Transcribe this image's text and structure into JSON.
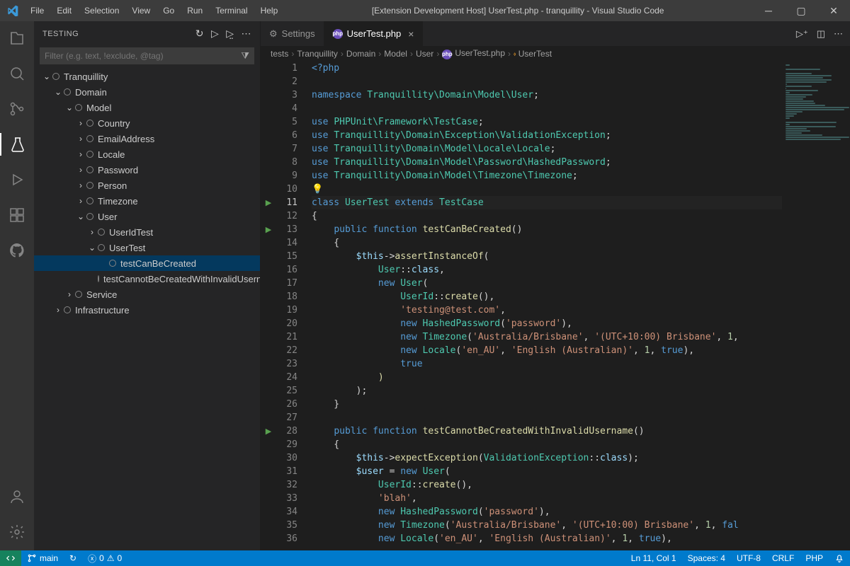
{
  "window": {
    "title": "[Extension Development Host] UserTest.php - tranquillity - Visual Studio Code",
    "menus": [
      "File",
      "Edit",
      "Selection",
      "View",
      "Go",
      "Run",
      "Terminal",
      "Help"
    ]
  },
  "sidebar": {
    "title": "TESTING",
    "filter_placeholder": "Filter (e.g. text, !exclude, @tag)",
    "tree": [
      {
        "indent": 0,
        "expanded": true,
        "label": "Tranquillity"
      },
      {
        "indent": 1,
        "expanded": true,
        "label": "Domain"
      },
      {
        "indent": 2,
        "expanded": true,
        "label": "Model"
      },
      {
        "indent": 3,
        "expanded": false,
        "label": "Country"
      },
      {
        "indent": 3,
        "expanded": false,
        "label": "EmailAddress"
      },
      {
        "indent": 3,
        "expanded": false,
        "label": "Locale"
      },
      {
        "indent": 3,
        "expanded": false,
        "label": "Password"
      },
      {
        "indent": 3,
        "expanded": false,
        "label": "Person"
      },
      {
        "indent": 3,
        "expanded": false,
        "label": "Timezone"
      },
      {
        "indent": 3,
        "expanded": true,
        "label": "User"
      },
      {
        "indent": 4,
        "expanded": false,
        "label": "UserIdTest"
      },
      {
        "indent": 4,
        "expanded": true,
        "label": "UserTest"
      },
      {
        "indent": 5,
        "leaf": true,
        "selected": true,
        "label": "testCanBeCreated"
      },
      {
        "indent": 5,
        "leaf": true,
        "label": "testCannotBeCreatedWithInvalidUsername"
      },
      {
        "indent": 2,
        "expanded": false,
        "label": "Service"
      },
      {
        "indent": 1,
        "expanded": false,
        "label": "Infrastructure"
      }
    ]
  },
  "tabs": [
    {
      "label": "Settings",
      "icon": "gear",
      "active": false,
      "closeable": false
    },
    {
      "label": "UserTest.php",
      "icon": "php",
      "active": true,
      "closeable": true
    }
  ],
  "breadcrumbs": [
    "tests",
    "Tranquillity",
    "Domain",
    "Model",
    "User",
    "UserTest.php",
    "UserTest"
  ],
  "editor": {
    "run_markers": {
      "11": true,
      "13": true,
      "28": true
    },
    "current_line": 11,
    "lines": [
      {
        "n": 1,
        "seg": [
          {
            "c": "kw",
            "t": "<?php"
          }
        ]
      },
      {
        "n": 2,
        "seg": []
      },
      {
        "n": 3,
        "seg": [
          {
            "c": "kw",
            "t": "namespace "
          },
          {
            "c": "ty",
            "t": "Tranquillity\\Domain\\Model\\User"
          },
          {
            "c": "pun",
            "t": ";"
          }
        ]
      },
      {
        "n": 4,
        "seg": []
      },
      {
        "n": 5,
        "seg": [
          {
            "c": "kw",
            "t": "use "
          },
          {
            "c": "ty",
            "t": "PHPUnit\\Framework\\"
          },
          {
            "c": "ty",
            "t": "TestCase"
          },
          {
            "c": "pun",
            "t": ";"
          }
        ]
      },
      {
        "n": 6,
        "seg": [
          {
            "c": "kw",
            "t": "use "
          },
          {
            "c": "ty",
            "t": "Tranquillity\\Domain\\Exception\\"
          },
          {
            "c": "ty",
            "t": "ValidationException"
          },
          {
            "c": "pun",
            "t": ";"
          }
        ]
      },
      {
        "n": 7,
        "seg": [
          {
            "c": "kw",
            "t": "use "
          },
          {
            "c": "ty",
            "t": "Tranquillity\\Domain\\Model\\Locale\\"
          },
          {
            "c": "ty",
            "t": "Locale"
          },
          {
            "c": "pun",
            "t": ";"
          }
        ]
      },
      {
        "n": 8,
        "seg": [
          {
            "c": "kw",
            "t": "use "
          },
          {
            "c": "ty",
            "t": "Tranquillity\\Domain\\Model\\Password\\"
          },
          {
            "c": "ty",
            "t": "HashedPassword"
          },
          {
            "c": "pun",
            "t": ";"
          }
        ]
      },
      {
        "n": 9,
        "seg": [
          {
            "c": "kw",
            "t": "use "
          },
          {
            "c": "ty",
            "t": "Tranquillity\\Domain\\Model\\Timezone\\"
          },
          {
            "c": "ty",
            "t": "Timezone"
          },
          {
            "c": "pun",
            "t": ";"
          }
        ]
      },
      {
        "n": 10,
        "seg": [
          {
            "c": "bulb",
            "t": "💡"
          }
        ]
      },
      {
        "n": 11,
        "seg": [
          {
            "c": "kw",
            "t": "class "
          },
          {
            "c": "ty",
            "t": "UserTest "
          },
          {
            "c": "kw",
            "t": "extends "
          },
          {
            "c": "ty",
            "t": "TestCase"
          }
        ]
      },
      {
        "n": 12,
        "seg": [
          {
            "c": "pun",
            "t": "{"
          }
        ]
      },
      {
        "n": 13,
        "seg": [
          {
            "c": "pun",
            "t": "    "
          },
          {
            "c": "kw",
            "t": "public "
          },
          {
            "c": "kw",
            "t": "function "
          },
          {
            "c": "fn",
            "t": "testCanBeCreated"
          },
          {
            "c": "pun",
            "t": "()"
          }
        ]
      },
      {
        "n": 14,
        "seg": [
          {
            "c": "pun",
            "t": "    {"
          }
        ]
      },
      {
        "n": 15,
        "seg": [
          {
            "c": "pun",
            "t": "        "
          },
          {
            "c": "var",
            "t": "$this"
          },
          {
            "c": "op",
            "t": "->"
          },
          {
            "c": "fn",
            "t": "assertInstanceOf"
          },
          {
            "c": "pun",
            "t": "("
          }
        ]
      },
      {
        "n": 16,
        "seg": [
          {
            "c": "pun",
            "t": "            "
          },
          {
            "c": "ty",
            "t": "User"
          },
          {
            "c": "pun",
            "t": "::"
          },
          {
            "c": "var",
            "t": "class"
          },
          {
            "c": "pun",
            "t": ","
          }
        ]
      },
      {
        "n": 17,
        "seg": [
          {
            "c": "pun",
            "t": "            "
          },
          {
            "c": "kw",
            "t": "new "
          },
          {
            "c": "ty",
            "t": "User"
          },
          {
            "c": "pun",
            "t": "("
          }
        ]
      },
      {
        "n": 18,
        "seg": [
          {
            "c": "pun",
            "t": "                "
          },
          {
            "c": "ty",
            "t": "UserId"
          },
          {
            "c": "pun",
            "t": "::"
          },
          {
            "c": "fn",
            "t": "create"
          },
          {
            "c": "pun",
            "t": "(),"
          }
        ]
      },
      {
        "n": 19,
        "seg": [
          {
            "c": "pun",
            "t": "                "
          },
          {
            "c": "str",
            "t": "'testing@test.com'"
          },
          {
            "c": "pun",
            "t": ","
          }
        ]
      },
      {
        "n": 20,
        "seg": [
          {
            "c": "pun",
            "t": "                "
          },
          {
            "c": "kw",
            "t": "new "
          },
          {
            "c": "ty",
            "t": "HashedPassword"
          },
          {
            "c": "pun",
            "t": "("
          },
          {
            "c": "str",
            "t": "'password'"
          },
          {
            "c": "pun",
            "t": "),"
          }
        ]
      },
      {
        "n": 21,
        "seg": [
          {
            "c": "pun",
            "t": "                "
          },
          {
            "c": "kw",
            "t": "new "
          },
          {
            "c": "ty",
            "t": "Timezone"
          },
          {
            "c": "pun",
            "t": "("
          },
          {
            "c": "str",
            "t": "'Australia/Brisbane'"
          },
          {
            "c": "pun",
            "t": ", "
          },
          {
            "c": "str",
            "t": "'(UTC+10:00) Brisbane'"
          },
          {
            "c": "pun",
            "t": ", "
          },
          {
            "c": "num",
            "t": "1"
          },
          {
            "c": "pun",
            "t": ","
          }
        ]
      },
      {
        "n": 22,
        "seg": [
          {
            "c": "pun",
            "t": "                "
          },
          {
            "c": "kw",
            "t": "new "
          },
          {
            "c": "ty",
            "t": "Locale"
          },
          {
            "c": "pun",
            "t": "("
          },
          {
            "c": "str",
            "t": "'en_AU'"
          },
          {
            "c": "pun",
            "t": ", "
          },
          {
            "c": "str",
            "t": "'English (Australian)'"
          },
          {
            "c": "pun",
            "t": ", "
          },
          {
            "c": "num",
            "t": "1"
          },
          {
            "c": "pun",
            "t": ", "
          },
          {
            "c": "bool",
            "t": "true"
          },
          {
            "c": "pun",
            "t": "),"
          }
        ]
      },
      {
        "n": 23,
        "seg": [
          {
            "c": "pun",
            "t": "                "
          },
          {
            "c": "bool",
            "t": "true"
          }
        ]
      },
      {
        "n": 24,
        "seg": [
          {
            "c": "pun",
            "t": "            "
          },
          {
            "c": "fn",
            "t": ")"
          }
        ]
      },
      {
        "n": 25,
        "seg": [
          {
            "c": "pun",
            "t": "        );"
          }
        ]
      },
      {
        "n": 26,
        "seg": [
          {
            "c": "pun",
            "t": "    }"
          }
        ]
      },
      {
        "n": 27,
        "seg": []
      },
      {
        "n": 28,
        "seg": [
          {
            "c": "pun",
            "t": "    "
          },
          {
            "c": "kw",
            "t": "public "
          },
          {
            "c": "kw",
            "t": "function "
          },
          {
            "c": "fn",
            "t": "testCannotBeCreatedWithInvalidUsername"
          },
          {
            "c": "pun",
            "t": "()"
          }
        ]
      },
      {
        "n": 29,
        "seg": [
          {
            "c": "pun",
            "t": "    {"
          }
        ]
      },
      {
        "n": 30,
        "seg": [
          {
            "c": "pun",
            "t": "        "
          },
          {
            "c": "var",
            "t": "$this"
          },
          {
            "c": "op",
            "t": "->"
          },
          {
            "c": "fn",
            "t": "expectException"
          },
          {
            "c": "pun",
            "t": "("
          },
          {
            "c": "ty",
            "t": "ValidationException"
          },
          {
            "c": "pun",
            "t": "::"
          },
          {
            "c": "var",
            "t": "class"
          },
          {
            "c": "pun",
            "t": ");"
          }
        ]
      },
      {
        "n": 31,
        "seg": [
          {
            "c": "pun",
            "t": "        "
          },
          {
            "c": "var",
            "t": "$user"
          },
          {
            "c": "pun",
            "t": " = "
          },
          {
            "c": "kw",
            "t": "new "
          },
          {
            "c": "ty",
            "t": "User"
          },
          {
            "c": "pun",
            "t": "("
          }
        ]
      },
      {
        "n": 32,
        "seg": [
          {
            "c": "pun",
            "t": "            "
          },
          {
            "c": "ty",
            "t": "UserId"
          },
          {
            "c": "pun",
            "t": "::"
          },
          {
            "c": "fn",
            "t": "create"
          },
          {
            "c": "pun",
            "t": "(),"
          }
        ]
      },
      {
        "n": 33,
        "seg": [
          {
            "c": "pun",
            "t": "            "
          },
          {
            "c": "str",
            "t": "'blah'"
          },
          {
            "c": "pun",
            "t": ","
          }
        ]
      },
      {
        "n": 34,
        "seg": [
          {
            "c": "pun",
            "t": "            "
          },
          {
            "c": "kw",
            "t": "new "
          },
          {
            "c": "ty",
            "t": "HashedPassword"
          },
          {
            "c": "pun",
            "t": "("
          },
          {
            "c": "str",
            "t": "'password'"
          },
          {
            "c": "pun",
            "t": "),"
          }
        ]
      },
      {
        "n": 35,
        "seg": [
          {
            "c": "pun",
            "t": "            "
          },
          {
            "c": "kw",
            "t": "new "
          },
          {
            "c": "ty",
            "t": "Timezone"
          },
          {
            "c": "pun",
            "t": "("
          },
          {
            "c": "str",
            "t": "'Australia/Brisbane'"
          },
          {
            "c": "pun",
            "t": ", "
          },
          {
            "c": "str",
            "t": "'(UTC+10:00) Brisbane'"
          },
          {
            "c": "pun",
            "t": ", "
          },
          {
            "c": "num",
            "t": "1"
          },
          {
            "c": "pun",
            "t": ", "
          },
          {
            "c": "bool",
            "t": "fal"
          }
        ]
      },
      {
        "n": 36,
        "seg": [
          {
            "c": "pun",
            "t": "            "
          },
          {
            "c": "kw",
            "t": "new "
          },
          {
            "c": "ty",
            "t": "Locale"
          },
          {
            "c": "pun",
            "t": "("
          },
          {
            "c": "str",
            "t": "'en_AU'"
          },
          {
            "c": "pun",
            "t": ", "
          },
          {
            "c": "str",
            "t": "'English (Australian)'"
          },
          {
            "c": "pun",
            "t": ", "
          },
          {
            "c": "num",
            "t": "1"
          },
          {
            "c": "pun",
            "t": ", "
          },
          {
            "c": "bool",
            "t": "true"
          },
          {
            "c": "pun",
            "t": "),"
          }
        ]
      }
    ]
  },
  "status": {
    "branch": "main",
    "sync": "↻",
    "errors": "0",
    "warnings": "0",
    "cursor": "Ln 11, Col 1",
    "spaces": "Spaces: 4",
    "encoding": "UTF-8",
    "eol": "CRLF",
    "language": "PHP",
    "bell": "🔔"
  }
}
